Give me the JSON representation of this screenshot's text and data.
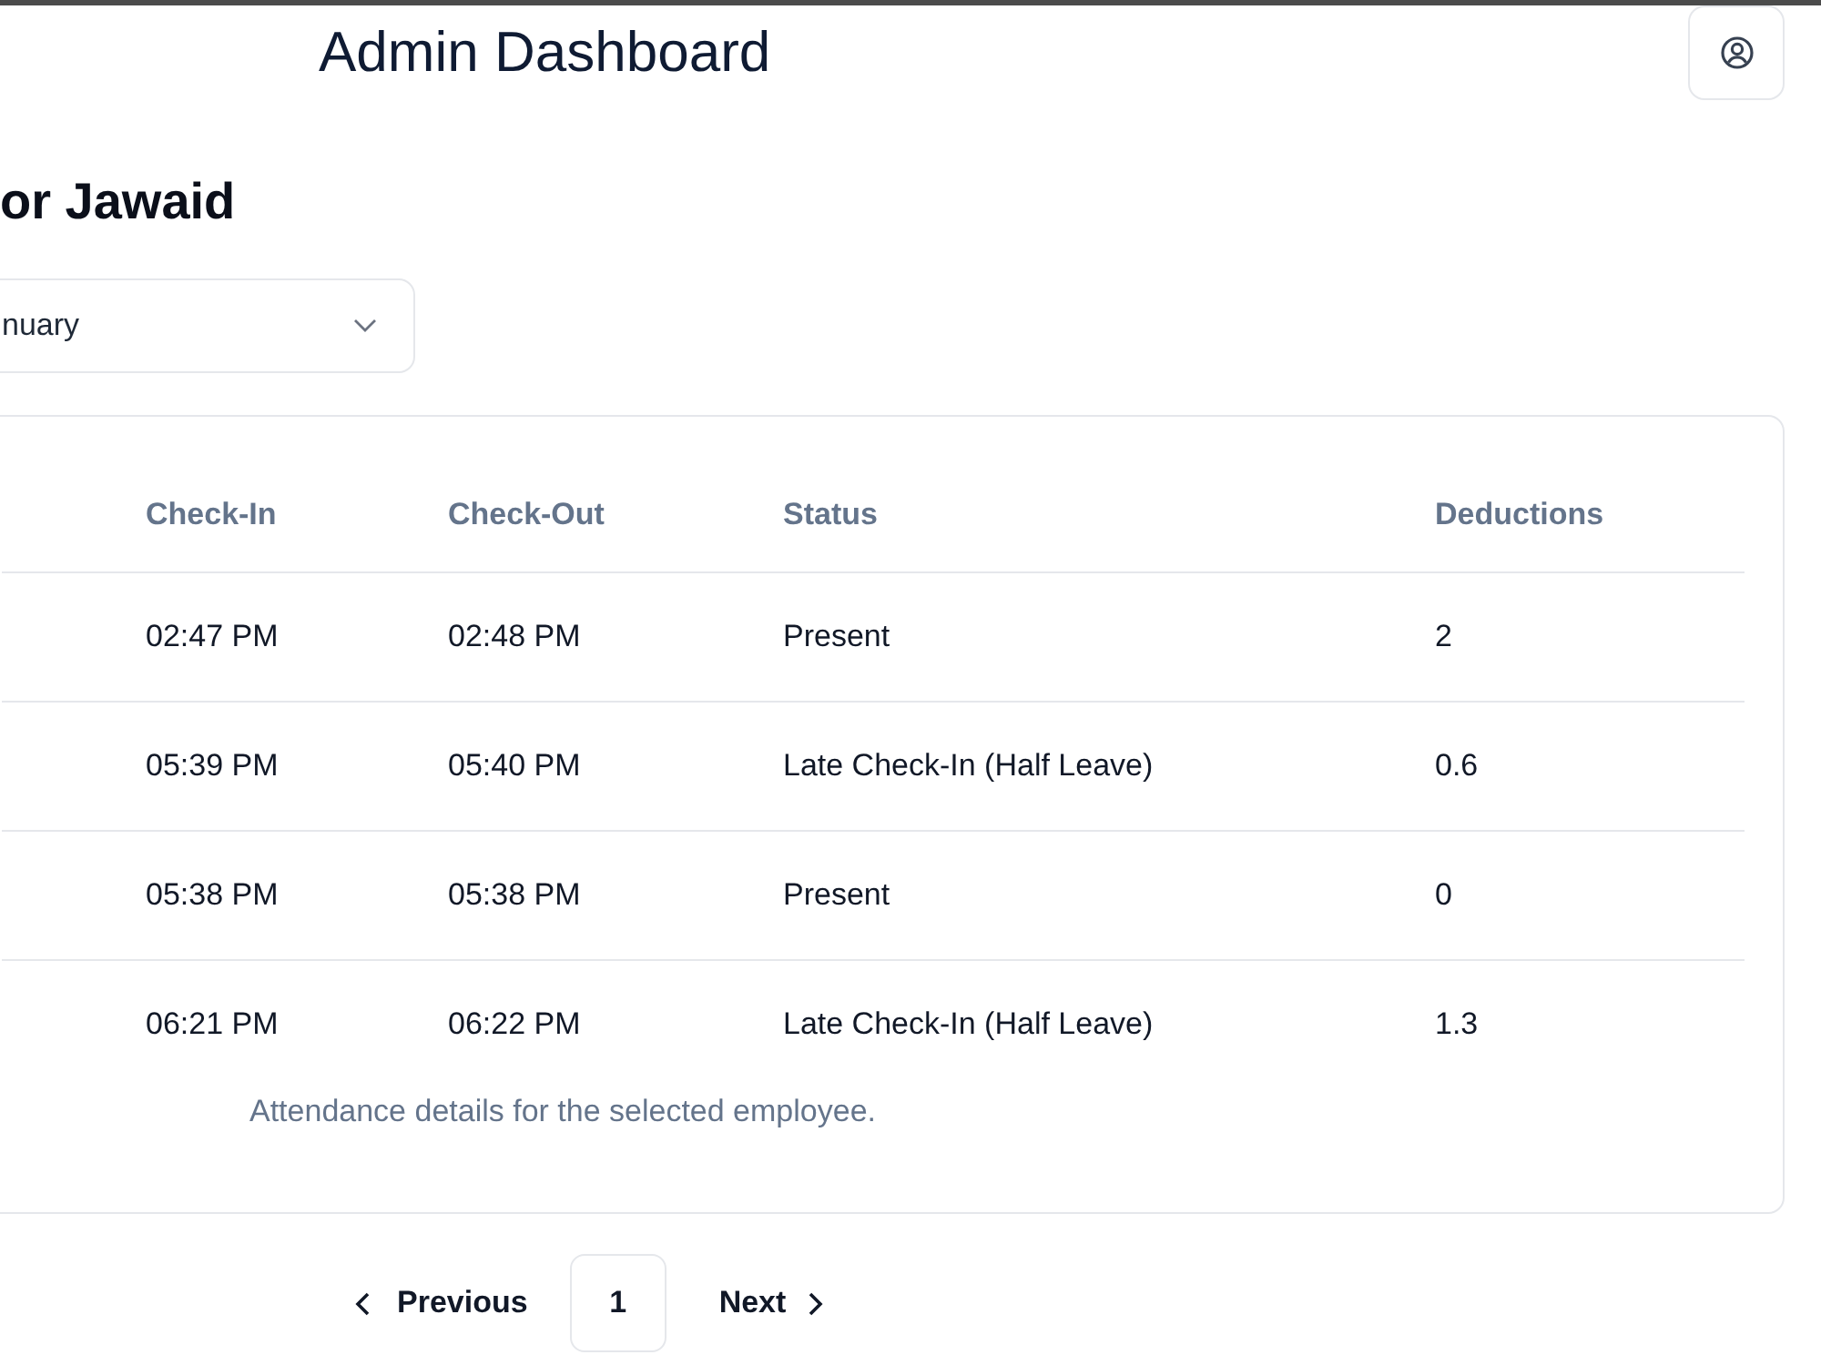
{
  "header": {
    "title": "Admin Dashboard"
  },
  "page": {
    "heading": "or Jawaid",
    "month_select": {
      "value": "nuary"
    }
  },
  "table": {
    "columns": [
      "Check-In",
      "Check-Out",
      "Status",
      "Deductions"
    ],
    "rows": [
      [
        "02:47 PM",
        "02:48 PM",
        "Present",
        "2"
      ],
      [
        "05:39 PM",
        "05:40 PM",
        "Late Check-In (Half Leave)",
        "0.6"
      ],
      [
        "05:38 PM",
        "05:38 PM",
        "Present",
        "0"
      ],
      [
        "06:21 PM",
        "06:22 PM",
        "Late Check-In (Half Leave)",
        "1.3"
      ]
    ],
    "caption": "Attendance details for the selected employee."
  },
  "pagination": {
    "previous": "Previous",
    "pages": [
      {
        "label": "1",
        "selected": true
      }
    ],
    "next": "Next"
  }
}
